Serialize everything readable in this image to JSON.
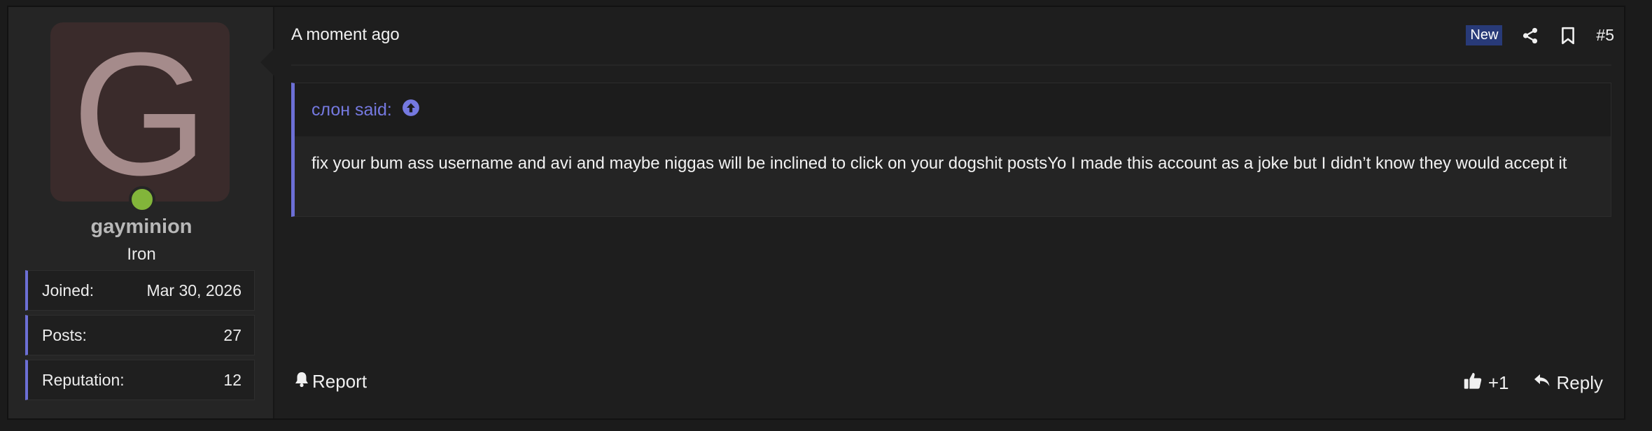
{
  "user": {
    "avatar_letter": "G",
    "username": "gayminion",
    "rank": "Iron",
    "online_color": "#82b53a",
    "stats": [
      {
        "label": "Joined:",
        "value": "Mar 30, 2026"
      },
      {
        "label": "Posts:",
        "value": "27"
      },
      {
        "label": "Reputation:",
        "value": "12"
      }
    ]
  },
  "post": {
    "time": "A moment ago",
    "badge": "New",
    "number": "#5",
    "icons": [
      "share-icon",
      "bookmark-icon"
    ],
    "quote": {
      "author_line": "слон said:",
      "text": "fix your bum ass username and avi and maybe niggas will be inclined to click on your dogshit postsYo I made this account as a joke but I didn’t know they would accept it"
    }
  },
  "footer": {
    "report_label": "Report",
    "like_label": "+1",
    "reply_label": "Reply"
  },
  "colors": {
    "accent": "#6c6fd6",
    "badge": "#283a78"
  }
}
